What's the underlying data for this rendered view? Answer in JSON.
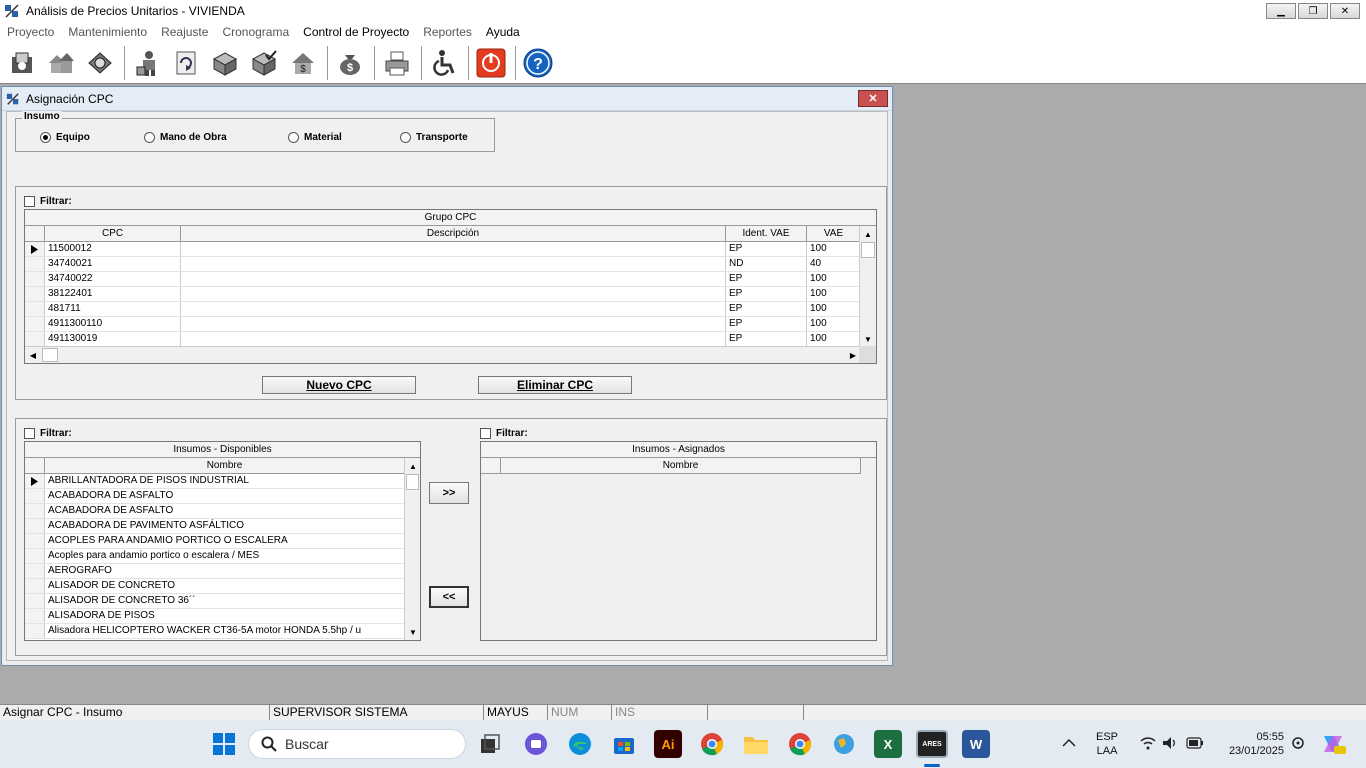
{
  "window": {
    "title": "Análisis de Precios Unitarios  -  VIVIENDA",
    "min": "▁",
    "restore": "❐",
    "close": "✕"
  },
  "menu": [
    "Proyecto",
    "Mantenimiento",
    "Reajuste",
    "Cronograma",
    "Control de Proyecto",
    "Reportes",
    "Ayuda"
  ],
  "dialog": {
    "title": "Asignación CPC",
    "close": "✕"
  },
  "insumo": {
    "label": "Insumo",
    "options": [
      "Equipo",
      "Mano de Obra",
      "Material",
      "Transporte"
    ],
    "selected": "Equipo"
  },
  "cpc": {
    "filter_label": "Filtrar:",
    "grid_title": "Grupo CPC",
    "columns": [
      "CPC",
      "Descripción",
      "Ident. VAE",
      "VAE"
    ],
    "rows": [
      [
        "11500012",
        "",
        "EP",
        "100"
      ],
      [
        "34740021",
        "",
        "ND",
        "40"
      ],
      [
        "34740022",
        "",
        "EP",
        "100"
      ],
      [
        "38122401",
        "",
        "EP",
        "100"
      ],
      [
        "481711",
        "",
        "EP",
        "100"
      ],
      [
        "4911300110",
        "",
        "EP",
        "100"
      ],
      [
        "491130019",
        "",
        "EP",
        "100"
      ]
    ],
    "new_button": "Nuevo CPC",
    "delete_button": "Eliminar CPC"
  },
  "disponibles": {
    "filter_label": "Filtrar:",
    "grid_title": "Insumos - Disponibles",
    "column": "Nombre",
    "rows": [
      "ABRILLANTADORA DE PISOS INDUSTRIAL",
      "ACABADORA  DE ASFALTO",
      "ACABADORA DE ASFALTO",
      "ACABADORA DE PAVIMENTO ASFÁLTICO",
      "ACOPLES PARA ANDAMIO PORTICO O ESCALERA",
      "Acoples para andamio portico o escalera / MES",
      "AEROGRAFO",
      "ALISADOR DE CONCRETO",
      "ALISADOR DE CONCRETO 36´´",
      "ALISADORA DE PISOS",
      "Alisadora HELICOPTERO WACKER CT36-5A motor HONDA 5.5hp / u"
    ]
  },
  "asignados": {
    "filter_label": "Filtrar:",
    "grid_title": "Insumos - Asignados",
    "column": "Nombre"
  },
  "transfer": {
    "add": ">>",
    "remove": "<<"
  },
  "status": {
    "action": "Asignar CPC - Insumo",
    "user": "SUPERVISOR SISTEMA",
    "caps": "MAYUS",
    "num": "NUM",
    "ins": "INS"
  },
  "taskbar": {
    "search_placeholder": "Buscar",
    "lang1": "ESP",
    "lang2": "LAA",
    "time": "05:55",
    "date": "23/01/2025",
    "excel": "X",
    "word": "W",
    "ai": "Ai",
    "ares": "ARES"
  },
  "colors": {
    "accent": "#316ac5",
    "close_red": "#c75050",
    "power_red": "#e23b1d",
    "help_blue": "#1565c0"
  }
}
